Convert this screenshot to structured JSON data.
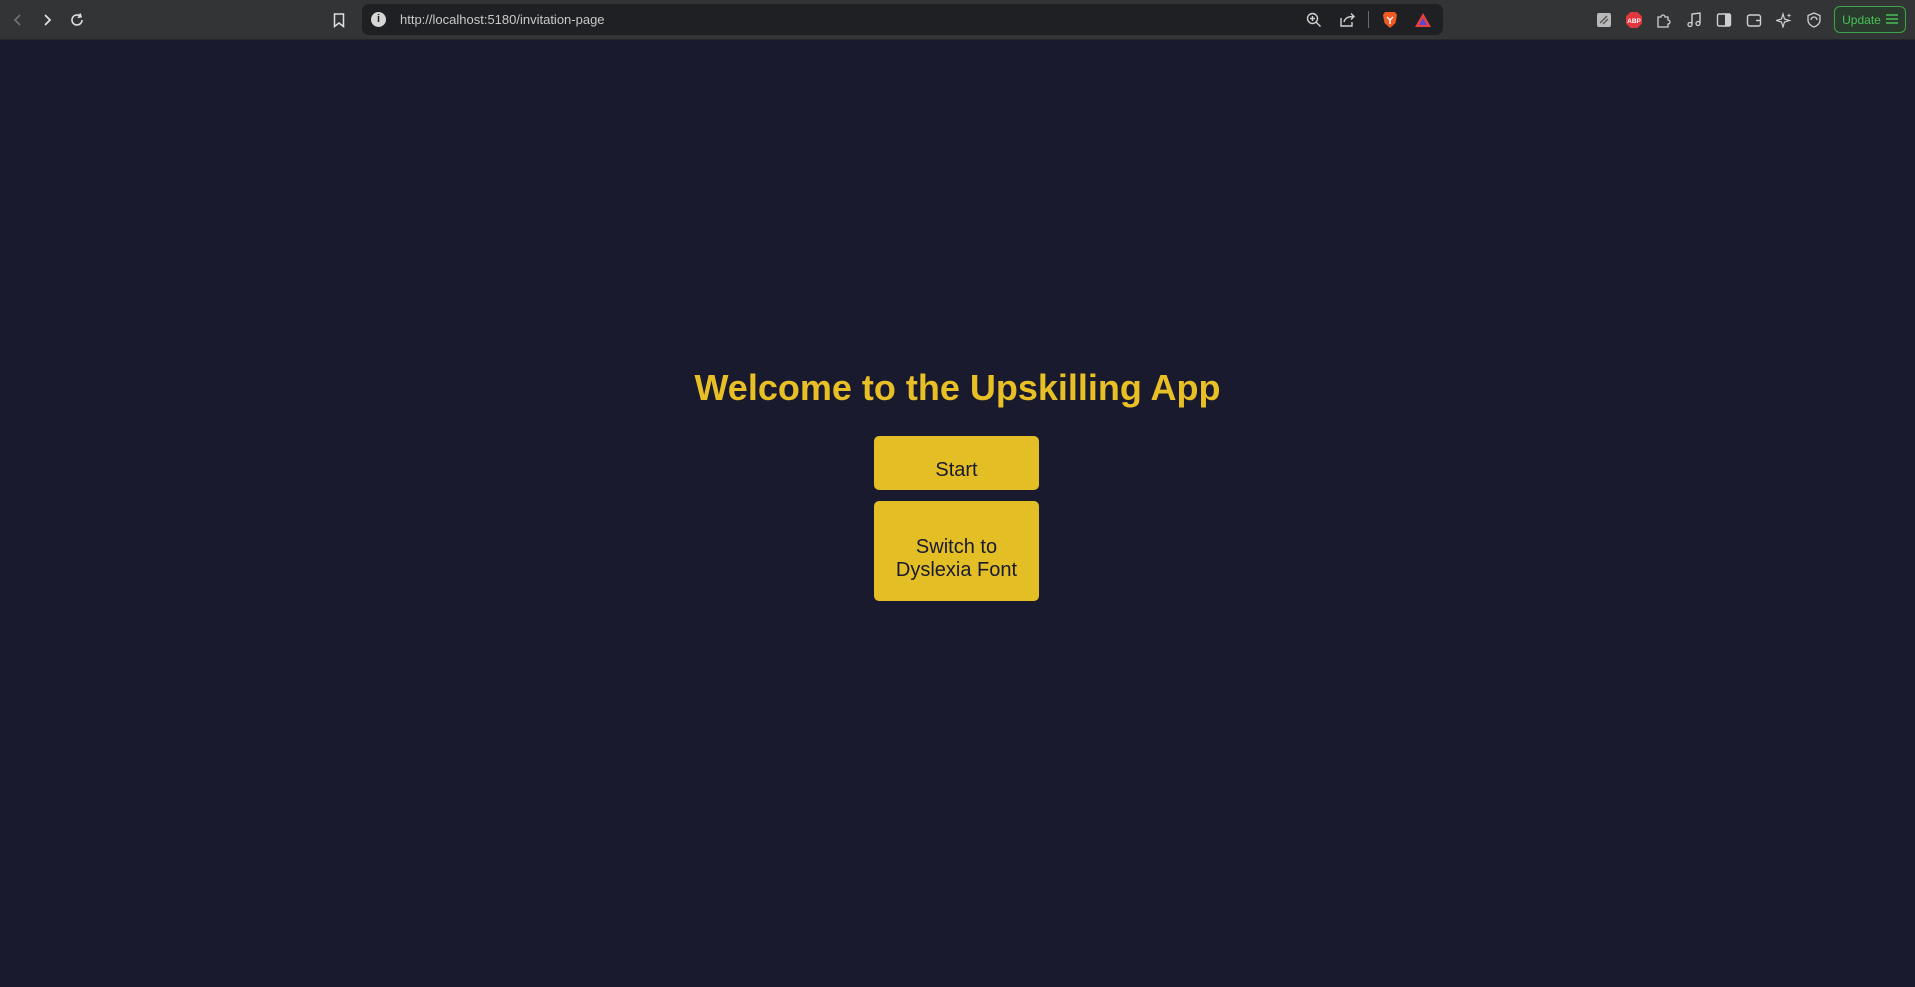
{
  "browser": {
    "url": "http://localhost:5180/invitation-page",
    "info_glyph": "i",
    "update_label": "Update",
    "icons": [
      "back-icon",
      "forward-icon",
      "reload-icon",
      "bookmark-icon",
      "zoom-icon",
      "share-icon",
      "brave-shield-icon",
      "brave-rewards-icon",
      "extension-sketch-icon",
      "adblock-icon",
      "puzzle-icon",
      "media-icon",
      "sidebar-icon",
      "wallet-icon",
      "leo-ai-icon",
      "vpn-icon",
      "menu-icon"
    ],
    "adblock_label": "ABP"
  },
  "page": {
    "title": "Welcome to the Upskilling App",
    "start_label": "Start",
    "dyslexia_label": "Switch to Dyslexia Font"
  },
  "colors": {
    "background": "#1a1a2e",
    "accent": "#e3be25",
    "button_text": "#1a1a2e"
  }
}
